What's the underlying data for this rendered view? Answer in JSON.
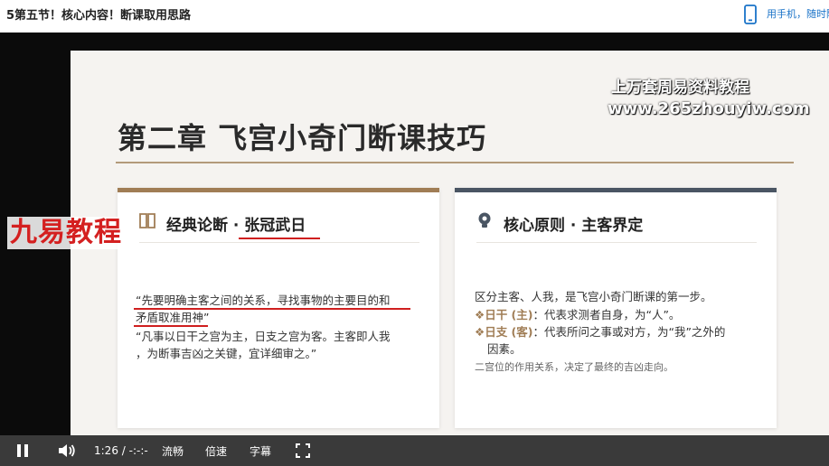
{
  "header": {
    "title": "5第五节！核心内容！断课取用思路",
    "phone_link": "用手机，随时随地看"
  },
  "slide": {
    "heading": "第二章 飞宫小奇门断课技巧",
    "left_card": {
      "title": "经典论断 · 张冠武日",
      "quote_1_line_1": "“先要明确主客之间的关系，寻找事物的主要目的和",
      "quote_1_line_2": "矛盾取准用神”",
      "quote_2_line_1": "“凡事以日干之宫为主，日支之宫为客。主客即人我",
      "quote_2_line_2": "，为断事吉凶之关键，宜详细审之。”"
    },
    "right_card": {
      "title": "核心原则 · 主客界定",
      "line_1": "区分主客、人我，是飞宫小奇门断课的第一步。",
      "line_2_label": "❖日干 (主)",
      "line_2_text": "：代表求测者自身，为“人”。",
      "line_3_label": "❖日支 (客)",
      "line_3_text": "：代表所问之事或对方，为“我”之外的",
      "line_4": "因素。",
      "line_5": "二宫位的作用关系，决定了最终的吉凶走向。"
    }
  },
  "watermarks": {
    "logo": "九易教程",
    "site_line_1": "上万套周易资料教程",
    "site_line_2": "www.265zhouyiw.com"
  },
  "player": {
    "time": "1:26 / -:-:-",
    "quality": "流畅",
    "speed": "倍速",
    "subtitles": "字幕"
  },
  "colors": {
    "accent_brown": "#a07d55",
    "accent_slate": "#4a5563",
    "annotation_red": "#cf1f1f",
    "link_blue": "#1a73c8",
    "control_bar": "#3a3a3a"
  },
  "icons": {
    "phone": "phone-icon",
    "book": "book-icon",
    "bulb": "lightbulb-icon",
    "pause": "pause-icon",
    "volume": "volume-icon",
    "fullscreen": "fullscreen-icon"
  }
}
